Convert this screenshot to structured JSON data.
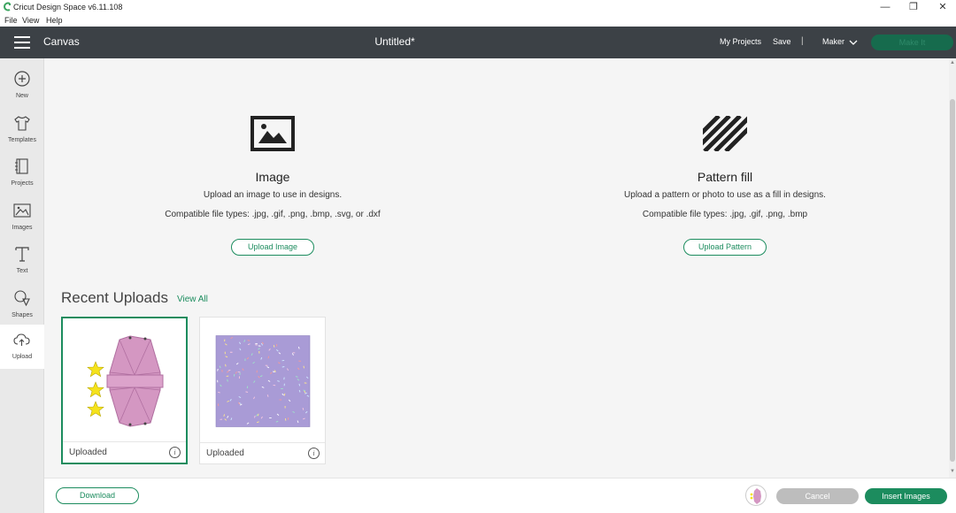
{
  "window": {
    "title": "Cricut Design Space  v6.11.108",
    "minimize_glyph": "—",
    "restore_glyph": "❐",
    "close_glyph": "✕"
  },
  "menubar": {
    "items": [
      "File",
      "View",
      "Help"
    ]
  },
  "header": {
    "section": "Canvas",
    "doc_title": "Untitled*",
    "my_projects": "My Projects",
    "save": "Save",
    "separator": "|",
    "machine": "Maker",
    "make_it": "Make It"
  },
  "sidebar": {
    "items": [
      {
        "label": "New",
        "icon": "plus-circle-icon"
      },
      {
        "label": "Templates",
        "icon": "tshirt-icon"
      },
      {
        "label": "Projects",
        "icon": "notebook-icon"
      },
      {
        "label": "Images",
        "icon": "image-icon"
      },
      {
        "label": "Text",
        "icon": "text-icon"
      },
      {
        "label": "Shapes",
        "icon": "shapes-icon"
      },
      {
        "label": "Upload",
        "icon": "cloud-upload-icon"
      }
    ],
    "active": "Upload"
  },
  "image_upload": {
    "heading": "Image",
    "description": "Upload an image to use in designs.",
    "types": "Compatible file types: .jpg, .gif, .png, .bmp, .svg, or .dxf",
    "button": "Upload Image"
  },
  "pattern_upload": {
    "heading": "Pattern fill",
    "description": "Upload a pattern or photo to use as a fill in designs.",
    "types": "Compatible file types: .jpg, .gif, .png, .bmp",
    "button": "Upload Pattern"
  },
  "recent": {
    "title": "Recent Uploads",
    "view_all": "View All",
    "cards": [
      {
        "label": "Uploaded",
        "info": "i",
        "selected": true
      },
      {
        "label": "Uploaded",
        "info": "i",
        "selected": false
      }
    ]
  },
  "bottom": {
    "download": "Download",
    "cancel": "Cancel",
    "insert": "Insert Images"
  },
  "colors": {
    "accent": "#1c8c5e",
    "header_bg": "#3c4146",
    "pattern_bg": "#a99bd6",
    "pink": "#d497c2",
    "star": "#f5e21c"
  }
}
